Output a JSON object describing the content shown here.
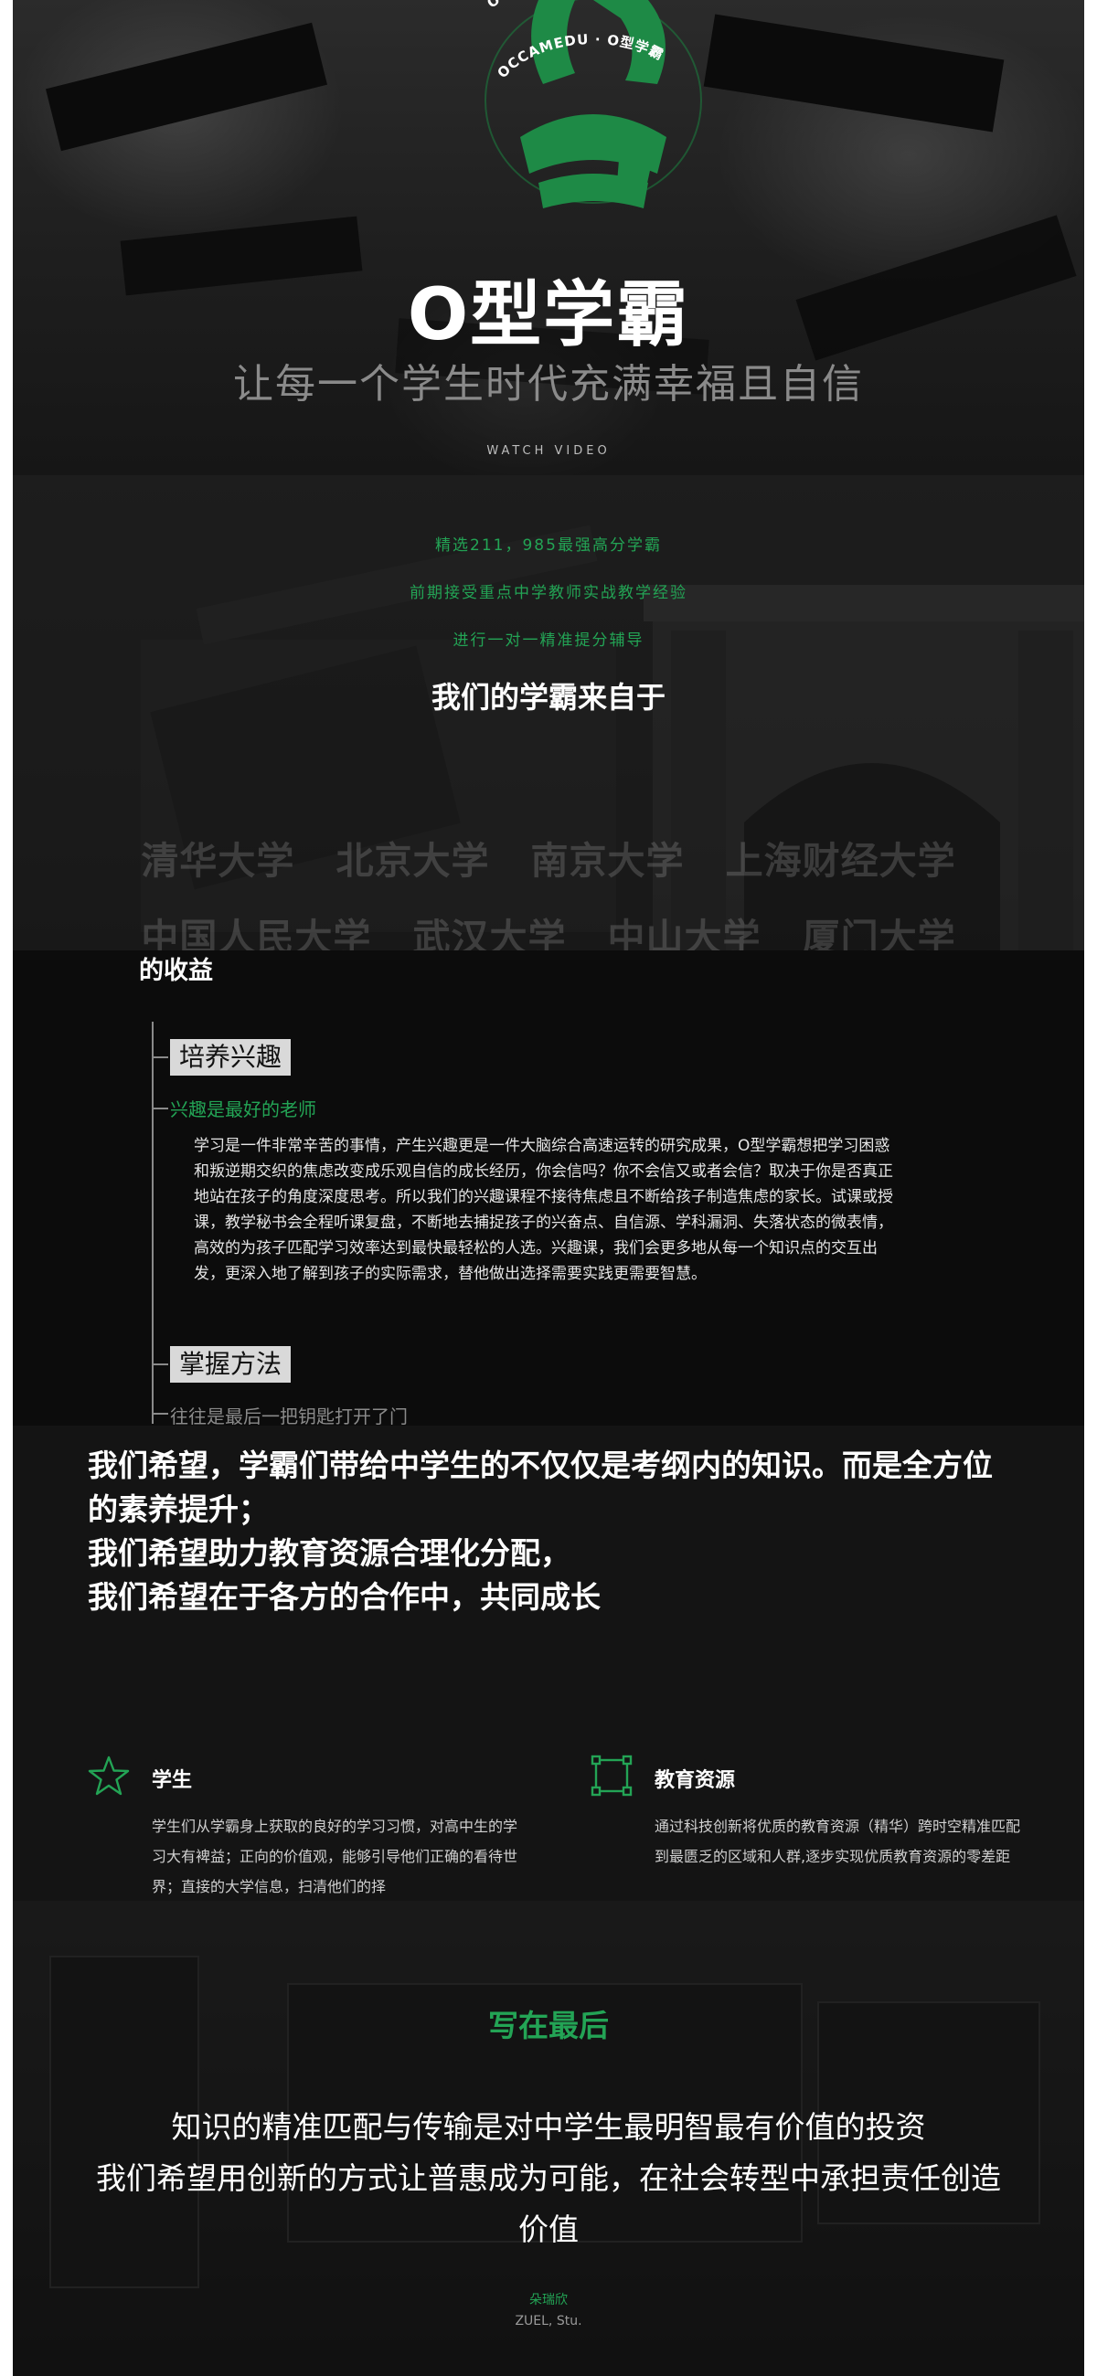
{
  "hero": {
    "logo_ring_text": "OCCAMEDU · O型学霸",
    "title": "O型学霸",
    "subtitle": "让每一个学生时代充满幸福且自信",
    "watch_video": "WATCH VIDEO"
  },
  "schools": {
    "lines": [
      "精选211，985最强高分学霸",
      "前期接受重点中学教师实战教学经验",
      "进行一对一精准提分辅导"
    ],
    "heading": "我们的学霸来自于",
    "row1": [
      "清华大学",
      "北京大学",
      "南京大学",
      "上海财经大学"
    ],
    "row2": [
      "中国人民大学",
      "武汉大学",
      "中山大学",
      "厦门大学"
    ]
  },
  "benefits": {
    "title": "的收益",
    "item1_tag": "培养兴趣",
    "item1_sub": "兴趣是最好的老师",
    "item1_text": "学习是一件非常辛苦的事情，产生兴趣更是一件大脑综合高速运转的研究成果，O型学霸想把学习困惑和叛逆期交织的焦虑改变成乐观自信的成长经历，你会信吗？你不会信又或者会信？取决于你是否真正地站在孩子的角度深度思考。所以我们的兴趣课程不接待焦虑且不断给孩子制造焦虑的家长。试课或授课，教学秘书会全程听课复盘，不断地去捕捉孩子的兴奋点、自信源、学科漏洞、失落状态的微表情，高效的为孩子匹配学习效率达到最快最轻松的人选。兴趣课，我们会更多地从每一个知识点的交互出发，更深入地了解到孩子的实际需求，替他做出选择需要实践更需要智慧。",
    "item2_tag": "掌握方法",
    "item2_sub": "往往是最后一把钥匙打开了门"
  },
  "hope": {
    "lines": [
      "我们希望，学霸们带给中学生的不仅仅是考纲内的知识。而是全方位的素养提升；",
      "我们希望助力教育资源合理化分配，",
      "我们希望在于各方的合作中，共同成长"
    ],
    "card1_title": "学生",
    "card1_text": "学生们从学霸身上获取的良好的学习习惯，对高中生的学习大有裨益；正向的价值观，能够引导他们正确的看待世界；直接的大学信息，扫清他们的择",
    "card2_title": "教育资源",
    "card2_text": "通过科技创新将优质的教育资源（精华）跨时空精准匹配到最匮乏的区域和人群,逐步实现优质教育资源的零差距"
  },
  "closing": {
    "title": "写在最后",
    "lines": [
      "知识的精准匹配与传输是对中学生最明智最有价值的投资",
      "我们希望用创新的方式让普惠成为可能，在社会转型中承担责任创造价值"
    ],
    "author": "朵瑞欣",
    "school": "ZUEL, Stu."
  },
  "colors": {
    "accent_green": "#23a455",
    "background": "#0c0c0c"
  }
}
